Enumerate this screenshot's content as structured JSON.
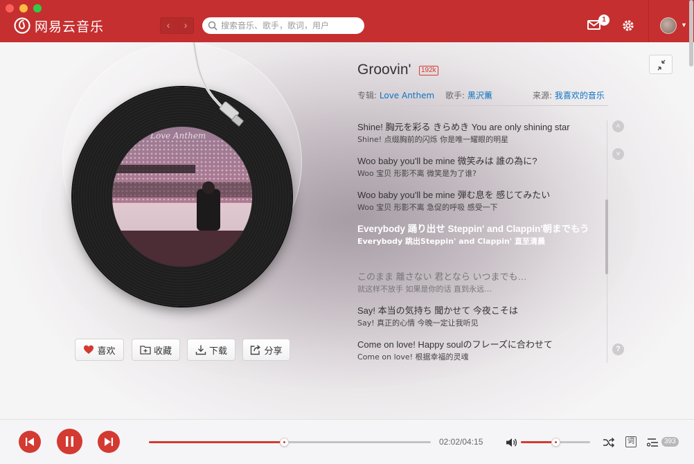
{
  "app": {
    "name": "网易云音乐"
  },
  "search": {
    "placeholder": "搜索音乐、歌手，歌词，用户"
  },
  "header": {
    "message_count": "1"
  },
  "song": {
    "title": "Groovin'",
    "quality": "192k",
    "album_label": "专辑:",
    "album": "Love Anthem",
    "artist_label": "歌手:",
    "artist": "黒沢薫",
    "source_label": "来源:",
    "source": "我喜欢的音乐"
  },
  "cover": {
    "text": "Love Anthem"
  },
  "actions": {
    "like": "喜欢",
    "collect": "收藏",
    "download": "下载",
    "share": "分享"
  },
  "lyrics": [
    {
      "orig": "Shine! 胸元を彩る きらめき You are only shining star",
      "tr": "Shine! 点缀胸前的闪烁 你是唯一耀眼的明星"
    },
    {
      "orig": "Woo baby you'll be mine 微笑みは 誰の為に?",
      "tr": "Woo 宝贝 形影不离 微笑是为了谁?"
    },
    {
      "orig": "Woo baby you'll be mine 弾む息を 感じてみたい",
      "tr": "Woo 宝贝 形影不离 急促的呼吸 感受一下"
    },
    {
      "orig": "Everybody 踊り出せ Steppin' and Clappin'朝までもう",
      "tr": "Everybody 跳出Steppin' and Clappin' 直至清晨"
    },
    {
      "orig": "このまま 離さない 君となら いつまでも…",
      "tr": "就这样不放手 如果是你的话 直到永远…"
    },
    {
      "orig": "Say! 本当の気持ち 聞かせて 今夜こそは",
      "tr": "Say! 真正的心情 今晚一定让我听见"
    },
    {
      "orig": "Come on love! Happy soulのフレーズに合わせて",
      "tr": "Come on love! 根据幸福的灵魂"
    }
  ],
  "player": {
    "elapsed": "02:02",
    "duration": "04:15",
    "time_display": "02:02/04:15",
    "progress": 0.48,
    "volume": 0.5,
    "lyric_toggle": "词",
    "playlist_count": "393"
  },
  "colors": {
    "brand": "#c62f2f",
    "accent": "#d33a31",
    "link": "#0c73c2"
  }
}
